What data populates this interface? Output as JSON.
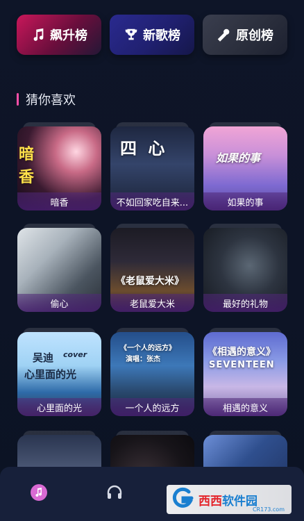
{
  "charts": {
    "hot": "飙升榜",
    "new": "新歌榜",
    "original": "原创榜"
  },
  "section": {
    "title": "猜你喜欢"
  },
  "songs": [
    {
      "title": "暗香",
      "cover_text": [
        "暗",
        "香"
      ]
    },
    {
      "title": "不如回家吃自来...",
      "cover_text": [
        "四 心"
      ]
    },
    {
      "title": "如果的事",
      "cover_text": [
        "如果的事"
      ]
    },
    {
      "title": "偷心",
      "cover_text": []
    },
    {
      "title": "老鼠爱大米",
      "cover_text": [
        "《老鼠爱大米》"
      ]
    },
    {
      "title": "最好的礼物",
      "cover_text": []
    },
    {
      "title": "心里面的光",
      "cover_text": [
        "吴迪",
        "cover",
        "心里面的光"
      ]
    },
    {
      "title": "一个人的远方",
      "cover_text": [
        "《一个人的远方》",
        "演唱：张杰"
      ]
    },
    {
      "title": "相遇的意义",
      "cover_text": [
        "《相遇的意义》",
        "SEVENTEEN"
      ]
    },
    {
      "title": "",
      "cover_text": []
    },
    {
      "title": "",
      "cover_text": []
    },
    {
      "title": "",
      "cover_text": []
    }
  ],
  "watermark": {
    "brand_a": "西西",
    "brand_b": "软件园",
    "url": "CR173.com"
  },
  "colors": {
    "accent_pink": "#ff4fa8",
    "nav_active": "#d96ad3",
    "background": "#0d1426"
  }
}
